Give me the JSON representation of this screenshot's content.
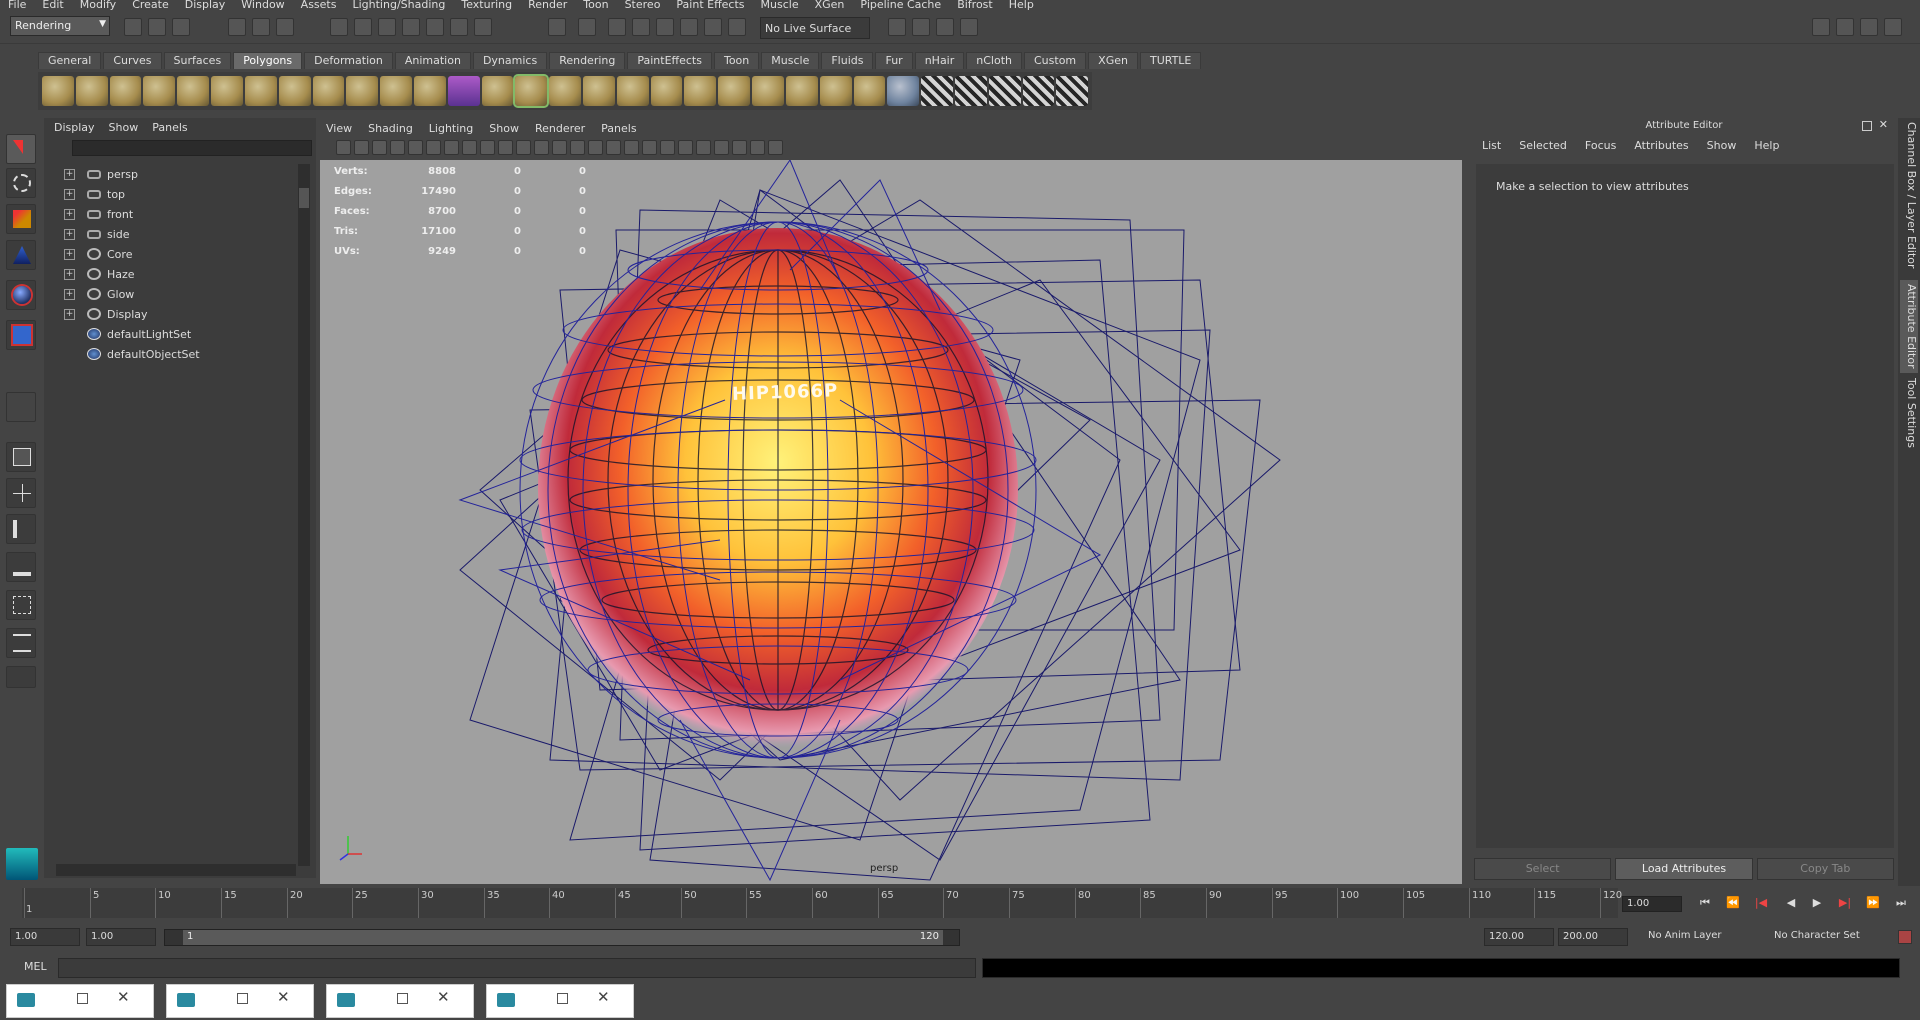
{
  "menus": [
    "File",
    "Edit",
    "Modify",
    "Create",
    "Display",
    "Window",
    "Assets",
    "Lighting/Shading",
    "Texturing",
    "Render",
    "Toon",
    "Stereo",
    "Paint Effects",
    "Muscle",
    "XGen",
    "Pipeline Cache",
    "Bifrost",
    "Help"
  ],
  "status": {
    "mode": "Rendering",
    "live_surface": "No Live Surface"
  },
  "shelf_tabs": [
    "General",
    "Curves",
    "Surfaces",
    "Polygons",
    "Deformation",
    "Animation",
    "Dynamics",
    "Rendering",
    "PaintEffects",
    "Toon",
    "Muscle",
    "Fluids",
    "Fur",
    "nHair",
    "nCloth",
    "Custom",
    "XGen",
    "TURTLE"
  ],
  "active_shelf_tab": "Polygons",
  "outliner": {
    "menu": [
      "Display",
      "Show",
      "Panels"
    ],
    "items": [
      {
        "label": "persp",
        "expandable": true,
        "icon": "camera-icon"
      },
      {
        "label": "top",
        "expandable": true,
        "icon": "camera-icon"
      },
      {
        "label": "front",
        "expandable": true,
        "icon": "camera-icon"
      },
      {
        "label": "side",
        "expandable": true,
        "icon": "camera-icon"
      },
      {
        "label": "Core",
        "expandable": true,
        "icon": "transform-icon"
      },
      {
        "label": "Haze",
        "expandable": true,
        "icon": "transform-icon"
      },
      {
        "label": "Glow",
        "expandable": true,
        "icon": "transform-icon"
      },
      {
        "label": "Display",
        "expandable": true,
        "icon": "transform-icon"
      },
      {
        "label": "defaultLightSet",
        "expandable": false,
        "icon": "set-icon"
      },
      {
        "label": "defaultObjectSet",
        "expandable": false,
        "icon": "set-icon"
      }
    ]
  },
  "viewport": {
    "menu": [
      "View",
      "Shading",
      "Lighting",
      "Show",
      "Renderer",
      "Panels"
    ],
    "hud": [
      {
        "label": "Verts:",
        "a": "8808",
        "b": "0",
        "c": "0"
      },
      {
        "label": "Edges:",
        "a": "17490",
        "b": "0",
        "c": "0"
      },
      {
        "label": "Faces:",
        "a": "8700",
        "b": "0",
        "c": "0"
      },
      {
        "label": "Tris:",
        "a": "17100",
        "b": "0",
        "c": "0"
      },
      {
        "label": "UVs:",
        "a": "9249",
        "b": "0",
        "c": "0"
      }
    ],
    "camera_label": "persp",
    "text_on_sphere": "HIP1066P"
  },
  "attribute_editor": {
    "title": "Attribute Editor",
    "menu": [
      "List",
      "Selected",
      "Focus",
      "Attributes",
      "Show",
      "Help"
    ],
    "message": "Make a selection to view attributes",
    "buttons": {
      "select": "Select",
      "load": "Load Attributes",
      "copy": "Copy Tab"
    }
  },
  "side_tabs": [
    "Channel Box / Layer Editor",
    "Attribute Editor",
    "Tool Settings"
  ],
  "timeline": {
    "ticks": [
      "1",
      "5",
      "10",
      "15",
      "20",
      "25",
      "30",
      "35",
      "40",
      "45",
      "50",
      "55",
      "60",
      "65",
      "70",
      "75",
      "80",
      "85",
      "90",
      "95",
      "100",
      "105",
      "110",
      "115",
      "120"
    ],
    "current_time": "1.00"
  },
  "range": {
    "start": "1.00",
    "anim_start": "1.00",
    "slider_start": "1",
    "slider_end": "120",
    "end": "120.00",
    "anim_end": "200.00",
    "anim_layer": "No Anim Layer",
    "character_set": "No Character Set"
  },
  "command_line": {
    "label": "MEL"
  },
  "minimized_windows": 4
}
